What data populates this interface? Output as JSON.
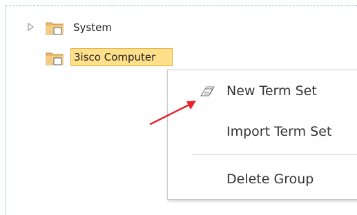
{
  "tree": {
    "items": [
      {
        "label": "System",
        "icon": "folder-icon",
        "expandable": true,
        "selected": false
      },
      {
        "label": "3isco Computer",
        "icon": "folder-icon",
        "expandable": false,
        "selected": true
      }
    ]
  },
  "context_menu": {
    "items": [
      {
        "label": "New Term Set",
        "icon": "term-set-icon"
      },
      {
        "label": "Import Term Set"
      },
      {
        "label": "Delete Group"
      }
    ]
  },
  "colors": {
    "selection_fill": "#ffe08a",
    "selection_border": "#e3ad3a",
    "annotation_arrow": "#e8232a"
  }
}
